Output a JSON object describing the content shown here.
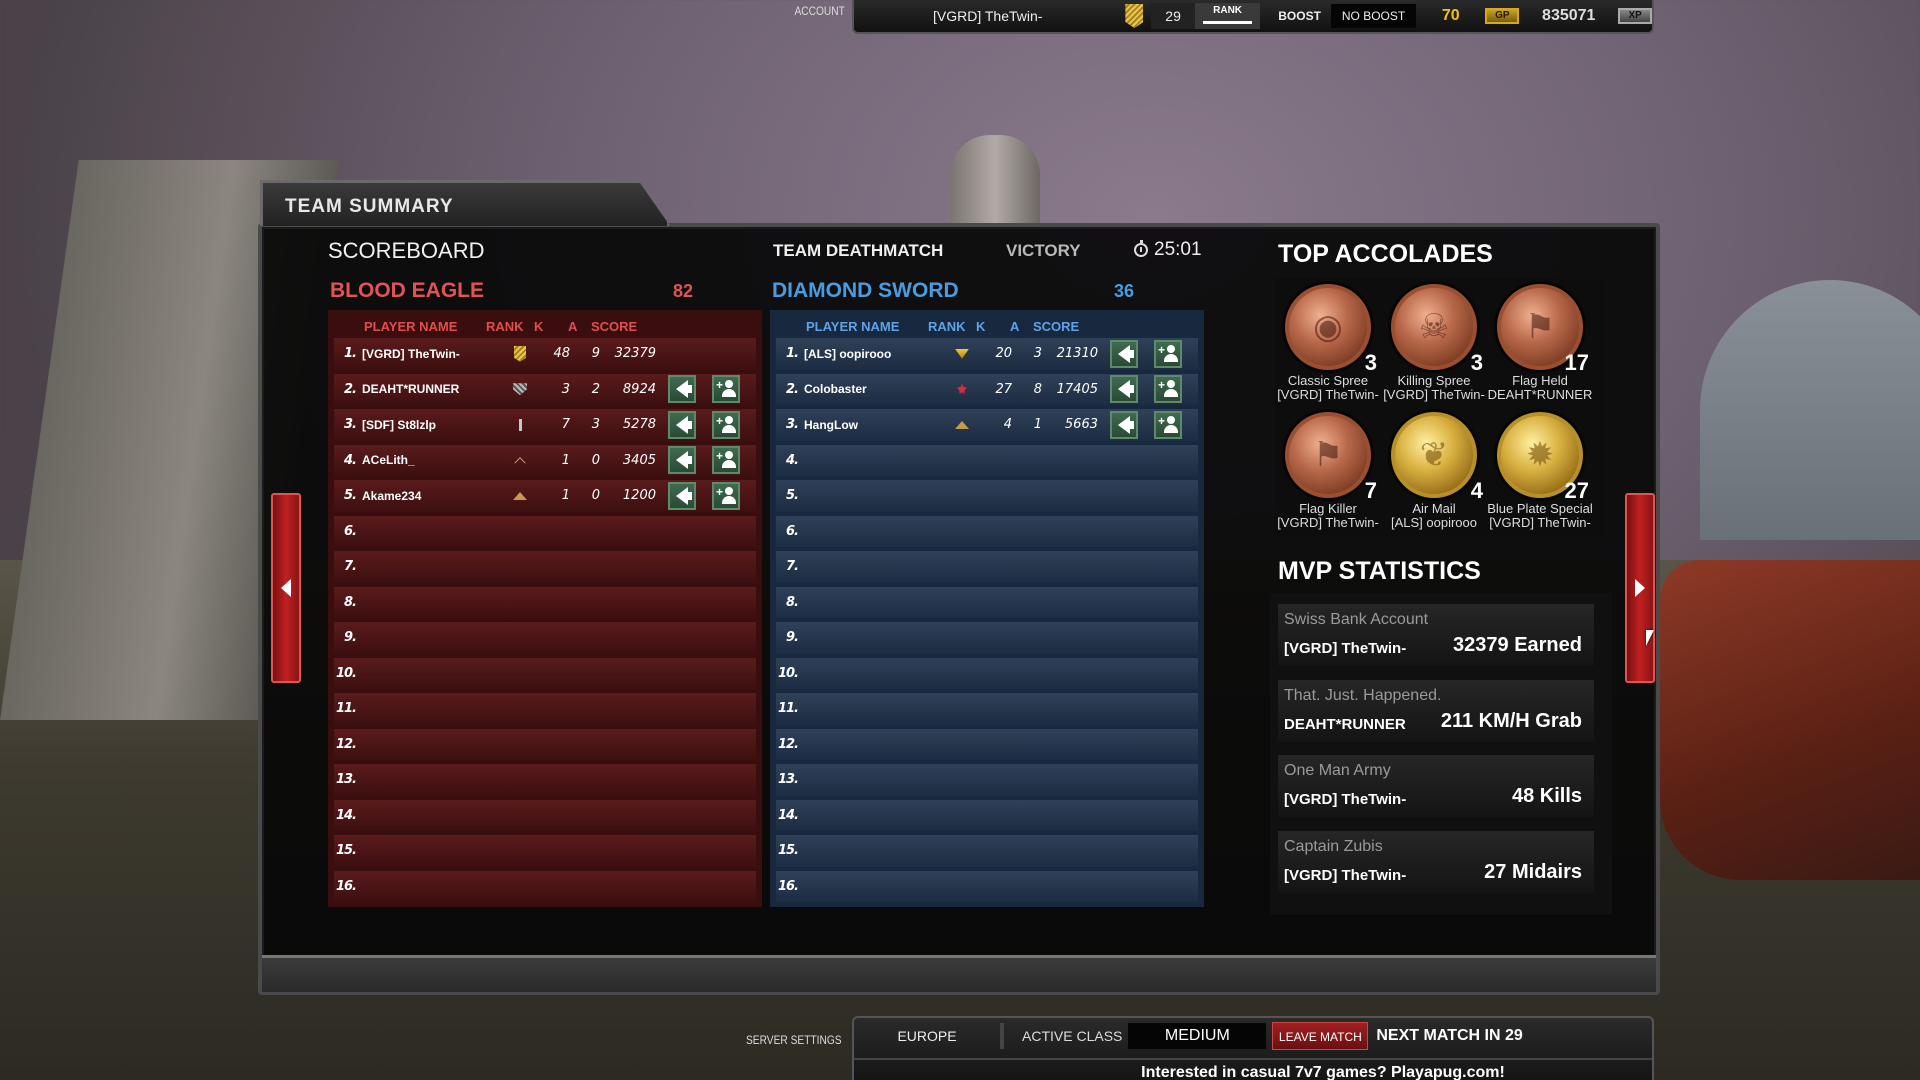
{
  "topbar": {
    "account_label": "ACCOUNT",
    "player_name": "[VGRD] TheTwin-",
    "rank_icon": "gold-rank-badge-icon",
    "level": "29",
    "rank_label": "RANK",
    "boost_label": "BOOST",
    "boost_value": "NO BOOST",
    "gp_value": "70",
    "gp_badge": "GP",
    "xp_value": "835071",
    "xp_badge": "XP"
  },
  "panel": {
    "tab_title": "TEAM SUMMARY",
    "scoreboard_title": "SCOREBOARD",
    "game_mode": "TEAM DEATHMATCH",
    "result": "VICTORY",
    "timer": "25:01"
  },
  "columns": {
    "player_name": "PLAYER NAME",
    "rank": "RANK",
    "k": "K",
    "a": "A",
    "score": "SCORE"
  },
  "teams": {
    "red": {
      "name": "BLOOD EAGLE",
      "score": "82",
      "color": "#e05454",
      "rows": [
        {
          "num": "1.",
          "name": "[VGRD] TheTwin-",
          "rank": "gold",
          "k": "48",
          "a": "9",
          "score": "32379",
          "self": true
        },
        {
          "num": "2.",
          "name": "DEAHT*RUNNER",
          "rank": "silver",
          "k": "3",
          "a": "2",
          "score": "8924",
          "self": false
        },
        {
          "num": "3.",
          "name": "[SDF] St8lzlp",
          "rank": "bar",
          "k": "7",
          "a": "3",
          "score": "5278",
          "self": false
        },
        {
          "num": "4.",
          "name": "ACeLith_",
          "rank": "chevron",
          "k": "1",
          "a": "0",
          "score": "3405",
          "self": false
        },
        {
          "num": "5.",
          "name": "Akame234",
          "rank": "triangle",
          "k": "1",
          "a": "0",
          "score": "1200",
          "self": false
        },
        {
          "num": "6."
        },
        {
          "num": "7."
        },
        {
          "num": "8."
        },
        {
          "num": "9."
        },
        {
          "num": "10."
        },
        {
          "num": "11."
        },
        {
          "num": "12."
        },
        {
          "num": "13."
        },
        {
          "num": "14."
        },
        {
          "num": "15."
        },
        {
          "num": "16."
        }
      ]
    },
    "blue": {
      "name": "DIAMOND SWORD",
      "score": "36",
      "color": "#4a9ce0",
      "rows": [
        {
          "num": "1.",
          "name": "[ALS] oopirooo",
          "rank": "gem",
          "k": "20",
          "a": "3",
          "score": "21310",
          "self": false
        },
        {
          "num": "2.",
          "name": "Colobaster",
          "rank": "star",
          "k": "27",
          "a": "8",
          "score": "17405",
          "self": false
        },
        {
          "num": "3.",
          "name": "HangLow",
          "rank": "triangle",
          "k": "4",
          "a": "1",
          "score": "5663",
          "self": false
        },
        {
          "num": "4."
        },
        {
          "num": "5."
        },
        {
          "num": "6."
        },
        {
          "num": "7."
        },
        {
          "num": "8."
        },
        {
          "num": "9."
        },
        {
          "num": "10."
        },
        {
          "num": "11."
        },
        {
          "num": "12."
        },
        {
          "num": "13."
        },
        {
          "num": "14."
        },
        {
          "num": "15."
        },
        {
          "num": "16."
        }
      ]
    }
  },
  "accolades": {
    "title": "TOP ACCOLADES",
    "items": [
      {
        "name": "Classic Spree",
        "player": "[VGRD] TheTwin-",
        "count": "3",
        "metal": "bronze",
        "icon": "disc-icon"
      },
      {
        "name": "Killing Spree",
        "player": "[VGRD] TheTwin-",
        "count": "3",
        "metal": "bronze",
        "icon": "skull-icon"
      },
      {
        "name": "Flag Held",
        "player": "DEAHT*RUNNER",
        "count": "17",
        "metal": "bronze",
        "icon": "flag-icon"
      },
      {
        "name": "Flag Killer",
        "player": "[VGRD] TheTwin-",
        "count": "7",
        "metal": "bronze",
        "icon": "flag-icon"
      },
      {
        "name": "Air Mail",
        "player": "[ALS] oopirooo",
        "count": "4",
        "metal": "gold",
        "icon": "winged-emblem-icon"
      },
      {
        "name": "Blue Plate Special",
        "player": "[VGRD] TheTwin-",
        "count": "27",
        "metal": "gold",
        "icon": "starburst-icon"
      }
    ]
  },
  "mvp": {
    "title": "MVP STATISTICS",
    "items": [
      {
        "label": "Swiss Bank Account",
        "player": "[VGRD] TheTwin-",
        "value": "32379 Earned"
      },
      {
        "label": "That. Just. Happened.",
        "player": "DEAHT*RUNNER",
        "value": "211 KM/H Grab"
      },
      {
        "label": "One Man Army",
        "player": "[VGRD] TheTwin-",
        "value": "48 Kills"
      },
      {
        "label": "Captain Zubis",
        "player": "[VGRD] TheTwin-",
        "value": "27 Midairs"
      }
    ]
  },
  "bottombar": {
    "server_settings_label": "SERVER SETTINGS",
    "region": "EUROPE",
    "active_class_label": "ACTIVE CLASS",
    "active_class": "MEDIUM",
    "leave_match": "LEAVE MATCH",
    "next_match": "NEXT MATCH IN 29",
    "message": "Interested in casual 7v7 games? Playapug.com!"
  }
}
